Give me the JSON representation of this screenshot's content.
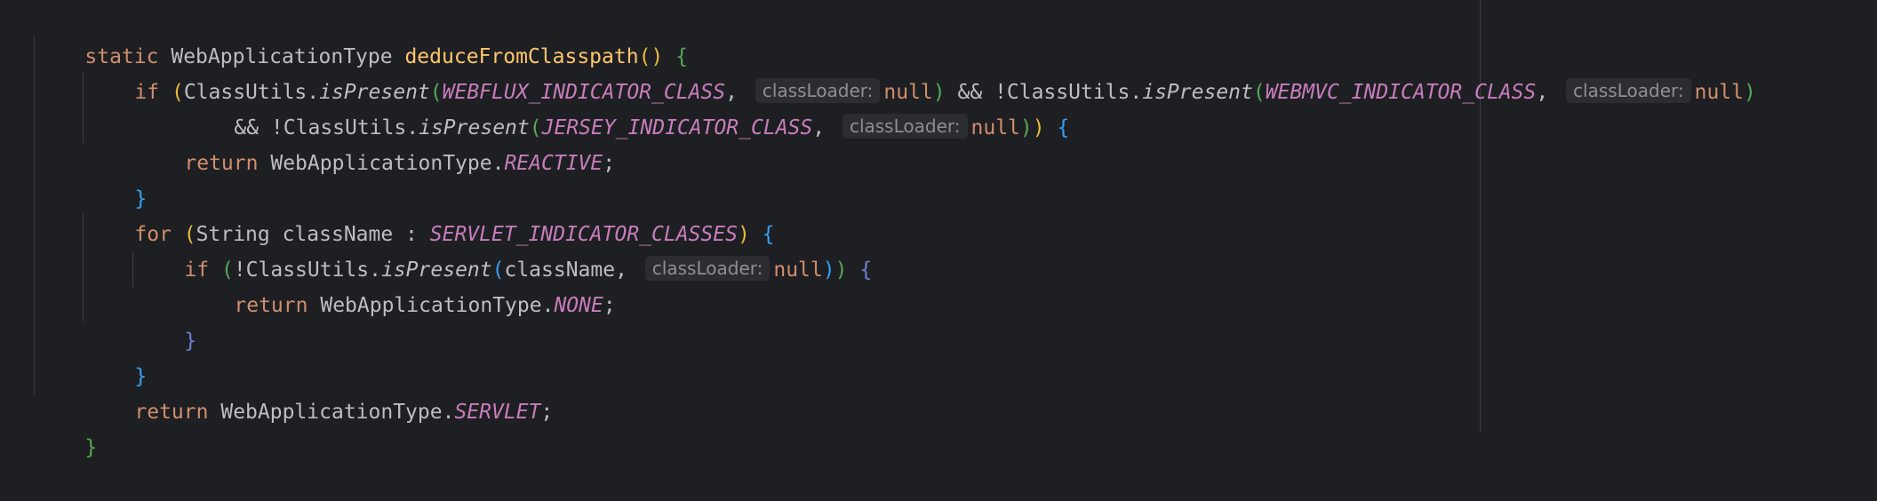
{
  "editor": {
    "line1": {
      "static_kw": "static",
      "return_type": "WebApplicationType",
      "method_name": "deduceFromClasspath",
      "paren_open": "(",
      "paren_close": ")",
      "brace_open": "{"
    },
    "line2": {
      "if_kw": "if",
      "paren_open": "(",
      "class_a": "ClassUtils.",
      "method_a": "isPresent",
      "paren_a_open": "(",
      "const_a": "WEBFLUX_INDICATOR_CLASS",
      "comma_a": ",",
      "hint_a": "classLoader:",
      "null_a": "null",
      "paren_a_close": ")",
      "and_not": " && !",
      "class_b": "ClassUtils.",
      "method_b": "isPresent",
      "paren_b_open": "(",
      "const_b": "WEBMVC_INDICATOR_CLASS",
      "comma_b": ",",
      "hint_b": "classLoader:",
      "null_b": "null",
      "paren_b_close": ")"
    },
    "line3": {
      "and_not": "&& !",
      "class": "ClassUtils.",
      "method": "isPresent",
      "paren_open": "(",
      "const": "JERSEY_INDICATOR_CLASS",
      "comma": ",",
      "hint": "classLoader:",
      "null": "null",
      "paren_inner_close": ")",
      "paren_outer_close": ")",
      "brace_open": "{"
    },
    "line4": {
      "return_kw": "return",
      "type": "WebApplicationType.",
      "const": "REACTIVE",
      "semicolon": ";"
    },
    "line5": {
      "brace_close": "}"
    },
    "line6": {
      "for_kw": "for",
      "paren_open": "(",
      "decl": "String className : ",
      "const": "SERVLET_INDICATOR_CLASSES",
      "paren_close": ")",
      "brace_open": "{"
    },
    "line7": {
      "if_kw": "if",
      "paren_open": "(",
      "class": "!ClassUtils.",
      "method": "isPresent",
      "paren_inner_open": "(",
      "arg": "className",
      "comma": ",",
      "hint": "classLoader:",
      "null": "null",
      "paren_inner_close": ")",
      "paren_outer_close": ")",
      "brace_open": "{"
    },
    "line8": {
      "return_kw": "return",
      "type": "WebApplicationType.",
      "const": "NONE",
      "semicolon": ";"
    },
    "line9": {
      "brace_close": "}"
    },
    "line10": {
      "brace_close": "}"
    },
    "line11": {
      "return_kw": "return",
      "type": "WebApplicationType.",
      "const": "SERVLET",
      "semicolon": ";"
    },
    "line12": {
      "brace_close": "}"
    }
  },
  "colors": {
    "background": "#1e1f22",
    "keyword": "#cf8e6d",
    "function": "#ffc66d",
    "constant": "#c77dbb",
    "text": "#bcbec4",
    "inlay_hint_bg": "#2b2d30",
    "inlay_hint_text": "#8c8f96"
  }
}
